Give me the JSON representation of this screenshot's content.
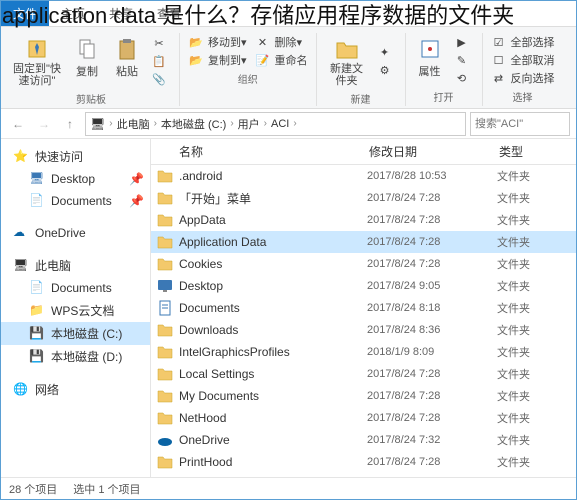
{
  "overlay_title": "application data 是什么？存储应用程序数据的文件夹",
  "tabs": {
    "file": "文件",
    "home": "主页",
    "share": "共享",
    "view": "查看"
  },
  "ribbon": {
    "pin_quick": "固定到\"快速访问\"",
    "copy": "复制",
    "paste": "粘贴",
    "clipboard_label": "剪贴板",
    "move_to": "移动到",
    "copy_to": "复制到",
    "delete": "删除",
    "rename": "重命名",
    "organize_label": "组织",
    "new_folder": "新建文件夹",
    "new_label": "新建",
    "properties": "属性",
    "open_label": "打开",
    "select_all": "全部选择",
    "select_none": "全部取消",
    "invert": "反向选择",
    "select_label": "选择"
  },
  "breadcrumb": {
    "pc": "此电脑",
    "drive": "本地磁盘 (C:)",
    "users": "用户",
    "user": "ACI"
  },
  "search_placeholder": "搜索\"ACI\"",
  "sidebar": {
    "quick_access": "快速访问",
    "desktop": "Desktop",
    "documents": "Documents",
    "onedrive": "OneDrive",
    "this_pc": "此电脑",
    "documents2": "Documents",
    "wps": "WPS云文档",
    "drive_c": "本地磁盘 (C:)",
    "drive_d": "本地磁盘 (D:)",
    "network": "网络"
  },
  "columns": {
    "name": "名称",
    "date": "修改日期",
    "type": "类型"
  },
  "files": [
    {
      "name": ".android",
      "date": "2017/8/28 10:53",
      "type": "文件夹",
      "icon": "folder",
      "selected": false
    },
    {
      "name": "「开始」菜单",
      "date": "2017/8/24 7:28",
      "type": "文件夹",
      "icon": "folder",
      "selected": false
    },
    {
      "name": "AppData",
      "date": "2017/8/24 7:28",
      "type": "文件夹",
      "icon": "folder",
      "selected": false
    },
    {
      "name": "Application Data",
      "date": "2017/8/24 7:28",
      "type": "文件夹",
      "icon": "folder",
      "selected": true
    },
    {
      "name": "Cookies",
      "date": "2017/8/24 7:28",
      "type": "文件夹",
      "icon": "folder",
      "selected": false
    },
    {
      "name": "Desktop",
      "date": "2017/8/24 9:05",
      "type": "文件夹",
      "icon": "desktop",
      "selected": false
    },
    {
      "name": "Documents",
      "date": "2017/8/24 8:18",
      "type": "文件夹",
      "icon": "documents",
      "selected": false
    },
    {
      "name": "Downloads",
      "date": "2017/8/24 8:36",
      "type": "文件夹",
      "icon": "folder",
      "selected": false
    },
    {
      "name": "IntelGraphicsProfiles",
      "date": "2018/1/9 8:09",
      "type": "文件夹",
      "icon": "folder",
      "selected": false
    },
    {
      "name": "Local Settings",
      "date": "2017/8/24 7:28",
      "type": "文件夹",
      "icon": "folder",
      "selected": false
    },
    {
      "name": "My Documents",
      "date": "2017/8/24 7:28",
      "type": "文件夹",
      "icon": "folder",
      "selected": false
    },
    {
      "name": "NetHood",
      "date": "2017/8/24 7:28",
      "type": "文件夹",
      "icon": "folder",
      "selected": false
    },
    {
      "name": "OneDrive",
      "date": "2017/8/24 7:32",
      "type": "文件夹",
      "icon": "onedrive",
      "selected": false
    },
    {
      "name": "PrintHood",
      "date": "2017/8/24 7:28",
      "type": "文件夹",
      "icon": "folder",
      "selected": false
    }
  ],
  "status": {
    "count": "28 个项目",
    "selected": "选中 1 个项目"
  }
}
